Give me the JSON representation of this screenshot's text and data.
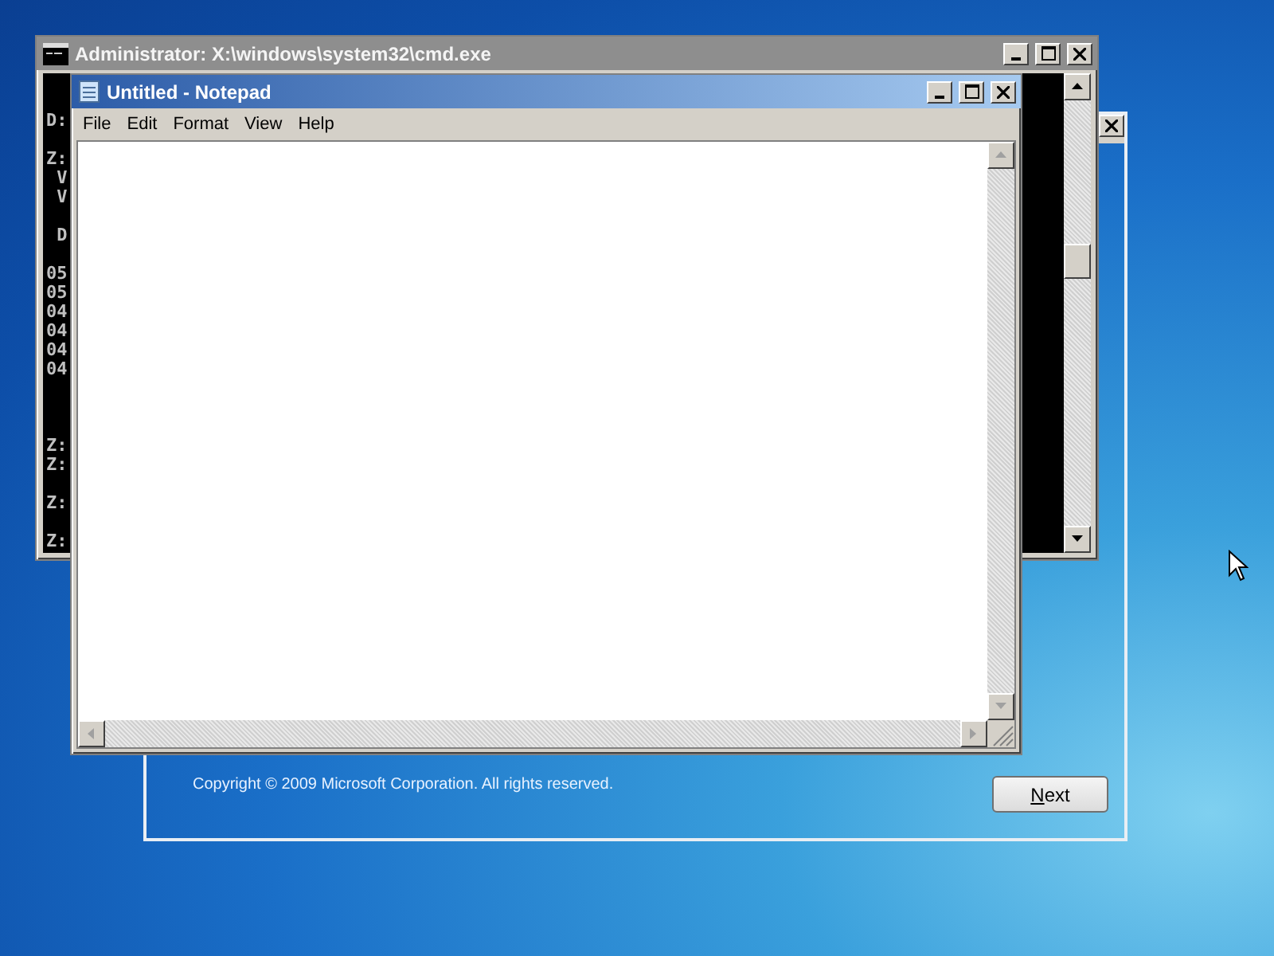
{
  "setup_window": {
    "copyright": "Copyright © 2009 Microsoft Corporation. All rights reserved.",
    "next_button": {
      "label": "Next"
    }
  },
  "console_window": {
    "title": "Administrator: X:\\windows\\system32\\cmd.exe",
    "active": false,
    "blocks": [
      [
        "D:"
      ],
      [
        "Z:",
        " V",
        " V"
      ],
      [
        " D"
      ],
      [
        "05",
        "05",
        "04",
        "04",
        "04",
        "04"
      ],
      [
        "Z:",
        "Z:"
      ],
      [
        "Z:"
      ],
      [
        "Z:"
      ]
    ]
  },
  "notepad_window": {
    "title": "Untitled - Notepad",
    "active": true,
    "menu": [
      "File",
      "Edit",
      "Format",
      "View",
      "Help"
    ]
  }
}
